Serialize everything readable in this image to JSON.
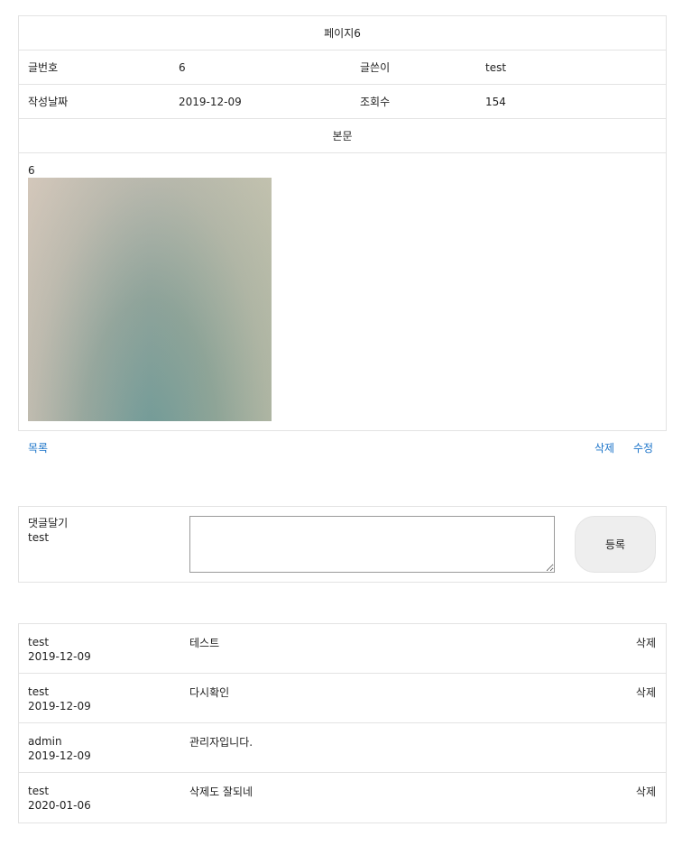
{
  "post": {
    "title": "페이지6",
    "no_label": "글번호",
    "no_value": "6",
    "writer_label": "글쓴이",
    "writer_value": "test",
    "date_label": "작성날짜",
    "date_value": "2019-12-09",
    "views_label": "조회수",
    "views_value": "154",
    "body_header": "본문",
    "body_text": "6"
  },
  "actions": {
    "list": "목록",
    "delete": "삭제",
    "edit": "수정"
  },
  "comment_form": {
    "label": "댓글달기",
    "user": "test",
    "textarea_value": "",
    "submit": "등록"
  },
  "comments": [
    {
      "user": "test",
      "date": "2019-12-09",
      "text": "테스트",
      "delete": "삭제"
    },
    {
      "user": "test",
      "date": "2019-12-09",
      "text": "다시확인",
      "delete": "삭제"
    },
    {
      "user": "admin",
      "date": "2019-12-09",
      "text": "관리자입니다.",
      "delete": ""
    },
    {
      "user": "test",
      "date": "2020-01-06",
      "text": "삭제도 잘되네",
      "delete": "삭제"
    }
  ]
}
